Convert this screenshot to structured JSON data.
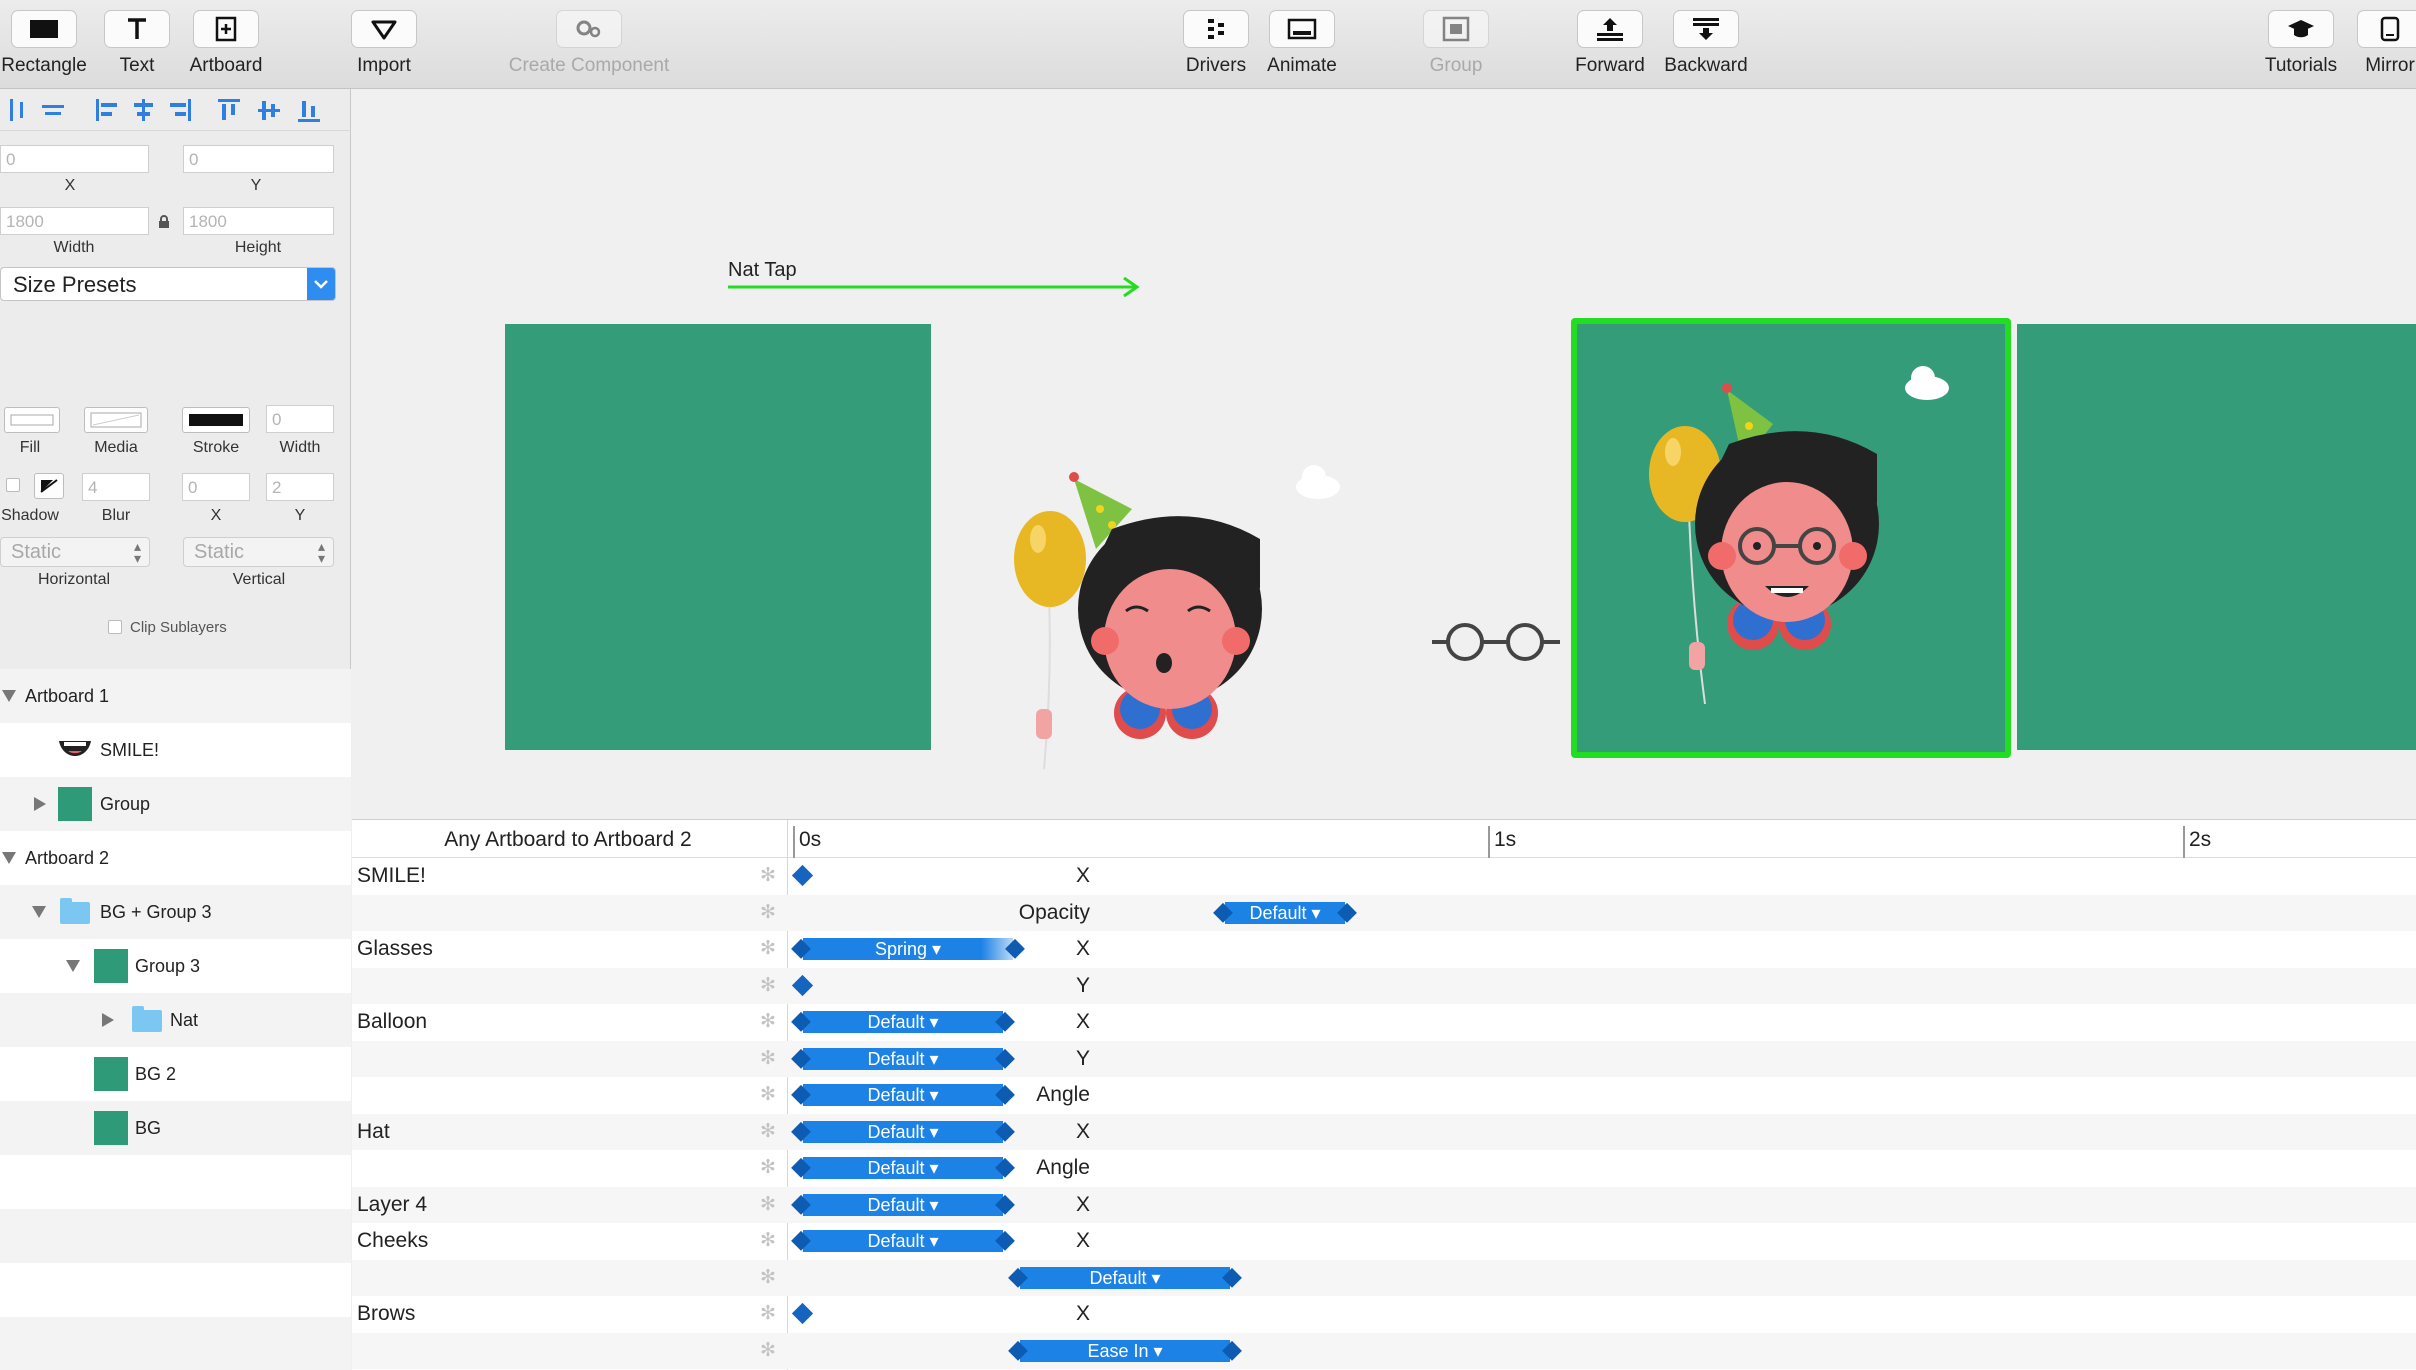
{
  "toolbar": {
    "rectangle": "Rectangle",
    "text": "Text",
    "artboard": "Artboard",
    "import": "Import",
    "create_component": "Create Component",
    "drivers": "Drivers",
    "animate": "Animate",
    "group": "Group",
    "forward": "Forward",
    "backward": "Backward",
    "tutorials": "Tutorials",
    "mirror": "Mirror"
  },
  "inspector": {
    "x_value": "0",
    "y_value": "0",
    "x_label": "X",
    "y_label": "Y",
    "width_value": "1800",
    "height_value": "1800",
    "width_label": "Width",
    "height_label": "Height",
    "size_presets": "Size Presets",
    "fill_label": "Fill",
    "media_label": "Media",
    "stroke_label": "Stroke",
    "stroke_width_label": "Width",
    "stroke_width_value": "0",
    "shadow_label": "Shadow",
    "blur_label": "Blur",
    "blur_value": "4",
    "shadow_x_label": "X",
    "shadow_x_value": "0",
    "shadow_y_label": "Y",
    "shadow_y_value": "2",
    "horizontal_value": "Static",
    "horizontal_label": "Horizontal",
    "vertical_value": "Static",
    "vertical_label": "Vertical",
    "clip_sublayers": "Clip Sublayers"
  },
  "layers": {
    "artboard1": "Artboard 1",
    "smile": "SMILE!",
    "group": "Group",
    "artboard2": "Artboard 2",
    "bg_group3": "BG + Group 3",
    "group3": "Group 3",
    "nat": "Nat",
    "bg2": "BG 2",
    "bg": "BG"
  },
  "canvas": {
    "connection_label": "Nat Tap",
    "accent_green": "#22dd22",
    "artboard_color": "#359c7a"
  },
  "timeline": {
    "title": "Any Artboard to Artboard 2",
    "ticks": [
      "0s",
      "1s",
      "2s"
    ],
    "rows": {
      "smile": "SMILE!",
      "x": "X",
      "y": "Y",
      "opacity": "Opacity",
      "angle": "Angle",
      "glasses": "Glasses",
      "balloon": "Balloon",
      "hat": "Hat",
      "layer4": "Layer 4",
      "cheeks": "Cheeks",
      "brows": "Brows"
    },
    "curves": {
      "default": "Default ▾",
      "spring": "Spring ▾",
      "ease_in": "Ease In ▾"
    }
  }
}
